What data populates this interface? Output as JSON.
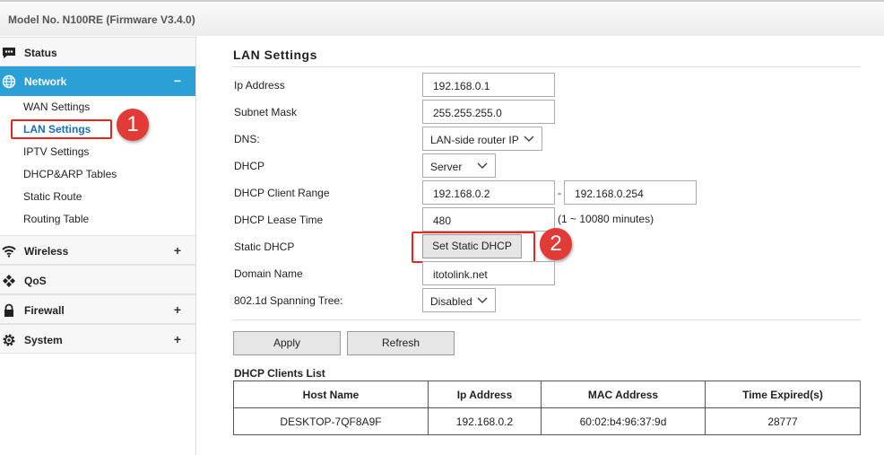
{
  "header": {
    "model": "Model No. N100RE (Firmware V3.4.0)"
  },
  "sidebar": {
    "status": {
      "label": "Status",
      "icon": "chat-dots-icon"
    },
    "network": {
      "label": "Network",
      "toggle": "−",
      "icon": "globe-icon",
      "items": [
        "WAN Settings",
        "LAN Settings",
        "IPTV Settings",
        "DHCP&ARP Tables",
        "Static Route",
        "Routing Table"
      ]
    },
    "wireless": {
      "label": "Wireless",
      "toggle": "+",
      "icon": "wifi-icon"
    },
    "qos": {
      "label": "QoS",
      "icon": "qos-diamonds-icon"
    },
    "firewall": {
      "label": "Firewall",
      "toggle": "+",
      "icon": "lock-icon"
    },
    "system": {
      "label": "System",
      "toggle": "+",
      "icon": "gear-icon"
    }
  },
  "callouts": {
    "one": "1",
    "two": "2"
  },
  "main": {
    "title": "LAN Settings",
    "fields": {
      "ip_label": "Ip Address",
      "ip_value": "192.168.0.1",
      "mask_label": "Subnet Mask",
      "mask_value": "255.255.255.0",
      "dns_label": "DNS:",
      "dns_value": "LAN-side router IP",
      "dhcp_label": "DHCP",
      "dhcp_value": "Server",
      "range_label": "DHCP Client Range",
      "range_start": "192.168.0.2",
      "range_sep": "-",
      "range_end": "192.168.0.254",
      "lease_label": "DHCP Lease Time",
      "lease_value": "480",
      "lease_note": "(1 ~ 10080 minutes)",
      "static_label": "Static DHCP",
      "static_button": "Set Static DHCP",
      "domain_label": "Domain Name",
      "domain_value": "itotolink.net",
      "stp_label": "802.1d Spanning Tree:",
      "stp_value": "Disabled"
    },
    "apply_label": "Apply",
    "refresh_label": "Refresh",
    "clients": {
      "title": "DHCP Clients List",
      "headers": [
        "Host Name",
        "Ip Address",
        "MAC Address",
        "Time Expired(s)"
      ],
      "rows": [
        [
          "DESKTOP-7QF8A9F",
          "192.168.0.2",
          "60:02:b4:96:37:9d",
          "28777"
        ]
      ]
    }
  },
  "colors": {
    "accent": "#2aa0d6",
    "callout": "#e23a36"
  }
}
